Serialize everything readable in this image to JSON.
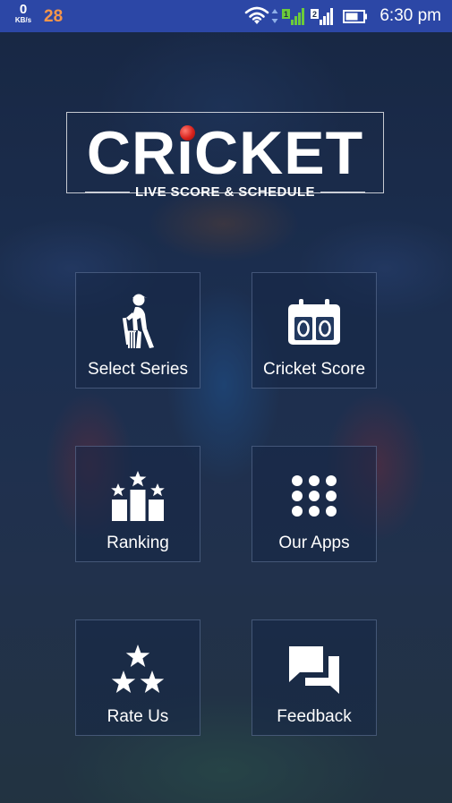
{
  "status_bar": {
    "speed_value": "0",
    "speed_unit": "KB/s",
    "notification_count": "28",
    "time": "6:30 pm",
    "sim1_label": "1",
    "sim2_label": "2"
  },
  "logo": {
    "title": "CRiCKET",
    "subtitle": "LIVE SCORE & SCHEDULE"
  },
  "menu": {
    "items": [
      {
        "label": "Select Series",
        "icon": "batsman-icon"
      },
      {
        "label": "Cricket Score",
        "icon": "scoreboard-icon"
      },
      {
        "label": "Ranking",
        "icon": "podium-stars-icon"
      },
      {
        "label": "Our Apps",
        "icon": "app-grid-icon"
      },
      {
        "label": "Rate Us",
        "icon": "three-stars-icon"
      },
      {
        "label": "Feedback",
        "icon": "chat-bubbles-icon"
      }
    ]
  },
  "colors": {
    "status_bar": "#2c47a6",
    "notification_count": "#f5954a",
    "signal_green": "#6ccb3a",
    "ball_red": "#d8231d"
  }
}
